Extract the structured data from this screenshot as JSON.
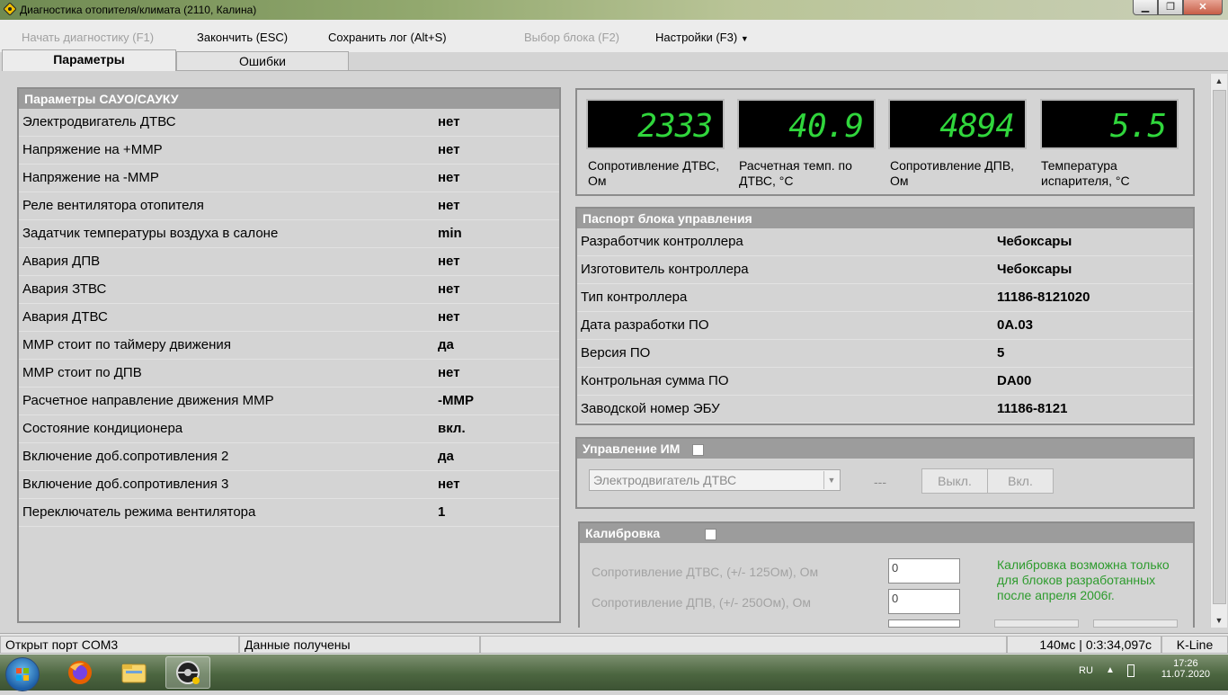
{
  "window": {
    "title": "Диагностика отопителя/климата (2110, Калина)"
  },
  "menu": [
    {
      "label": "Начать диагностику (F1)",
      "disabled": true
    },
    {
      "label": "Закончить (ESC)",
      "disabled": false
    },
    {
      "label": "Сохранить лог (Alt+S)",
      "disabled": false
    },
    {
      "label": "Выбор блока (F2)",
      "disabled": true
    },
    {
      "label": "Настройки (F3)",
      "disabled": false
    }
  ],
  "tabs": [
    "Параметры",
    "Ошибки"
  ],
  "params": {
    "title": "Параметры САУО/САУКУ",
    "rows": [
      {
        "label": "Электродвигатель ДТВС",
        "value": "нет"
      },
      {
        "label": "Напряжение на +ММР",
        "value": "нет"
      },
      {
        "label": "Напряжение на -ММР",
        "value": "нет"
      },
      {
        "label": "Реле вентилятора отопителя",
        "value": "нет"
      },
      {
        "label": "Задатчик температуры воздуха в салоне",
        "value": "min"
      },
      {
        "label": "Авария ДПВ",
        "value": "нет"
      },
      {
        "label": "Авария ЗТВС",
        "value": "нет"
      },
      {
        "label": "Авария ДТВС",
        "value": "нет"
      },
      {
        "label": "ММР стоит по таймеру движения",
        "value": "да"
      },
      {
        "label": "ММР стоит по ДПВ",
        "value": "нет"
      },
      {
        "label": "Расчетное направление движения ММР",
        "value": "-ММР"
      },
      {
        "label": "Состояние кондиционера",
        "value": "вкл."
      },
      {
        "label": "Включение доб.сопротивления 2",
        "value": "да"
      },
      {
        "label": "Включение доб.сопротивления 3",
        "value": "нет"
      },
      {
        "label": "Переключатель режима вентилятора",
        "value": "1"
      }
    ]
  },
  "gauges": [
    {
      "value": "2333",
      "label": "Сопротивление ДТВС, Ом"
    },
    {
      "value": "40.9",
      "label": "Расчетная темп. по ДТВС, °С"
    },
    {
      "value": "4894",
      "label": "Сопротивление ДПВ, Ом"
    },
    {
      "value": "5.5",
      "label": "Температура испарителя, °С"
    }
  ],
  "passport": {
    "title": "Паспорт блока управления",
    "rows": [
      {
        "label": "Разработчик контроллера",
        "value": "Чебоксары"
      },
      {
        "label": "Изготовитель контроллера",
        "value": "Чебоксары"
      },
      {
        "label": "Тип контроллера",
        "value": "11186-8121020"
      },
      {
        "label": "Дата разработки ПО",
        "value": "0A.03"
      },
      {
        "label": "Версия ПО",
        "value": "5"
      },
      {
        "label": "Контрольная сумма ПО",
        "value": "DA00"
      },
      {
        "label": "Заводской номер ЭБУ",
        "value": "11186-8121"
      }
    ]
  },
  "im_control": {
    "title": "Управление ИМ",
    "combo_value": "Электродвигатель ДТВС",
    "state": "---",
    "off_label": "Выкл.",
    "on_label": "Вкл."
  },
  "calibration": {
    "title": "Калибровка",
    "dtvs_label": "Сопротивление ДТВС, (+/- 125Ом), Ом",
    "dtvs_value": "0",
    "dpv_label": "Сопротивление ДПВ, (+/- 250Ом), Ом",
    "dpv_value": "0",
    "note": "Калибровка возможна только для блоков разработанных после апреля 2006г."
  },
  "status": {
    "port": "Открыт порт COM3",
    "data": "Данные получены",
    "timing": "140мс | 0:3:34,097с",
    "protocol": "K-Line"
  },
  "tray": {
    "lang": "RU",
    "time": "17:26",
    "date": "11.07.2020"
  },
  "colors": {
    "header_bg": "#9c9c9c",
    "digit": "#30d63c",
    "note": "#2d9b2d"
  }
}
